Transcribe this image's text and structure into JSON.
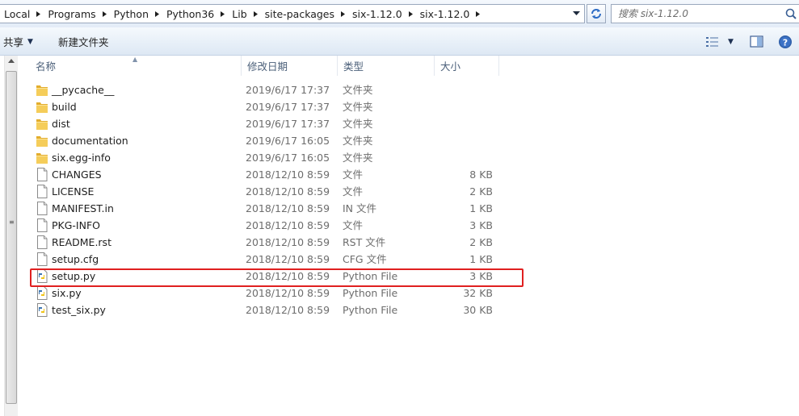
{
  "address_bar": {
    "breadcrumbs": [
      "Local",
      "Programs",
      "Python",
      "Python36",
      "Lib",
      "site-packages",
      "six-1.12.0",
      "six-1.12.0"
    ]
  },
  "search": {
    "placeholder": "搜索 six-1.12.0"
  },
  "toolbar": {
    "share_label": "共享",
    "new_folder_label": "新建文件夹"
  },
  "columns": {
    "name": "名称",
    "date": "修改日期",
    "type": "类型",
    "size": "大小"
  },
  "files": [
    {
      "name": "__pycache__",
      "date": "2019/6/17 17:37",
      "type": "文件夹",
      "size": "",
      "icon": "folder-icon"
    },
    {
      "name": "build",
      "date": "2019/6/17 17:37",
      "type": "文件夹",
      "size": "",
      "icon": "folder-icon"
    },
    {
      "name": "dist",
      "date": "2019/6/17 17:37",
      "type": "文件夹",
      "size": "",
      "icon": "folder-icon"
    },
    {
      "name": "documentation",
      "date": "2019/6/17 16:05",
      "type": "文件夹",
      "size": "",
      "icon": "folder-icon"
    },
    {
      "name": "six.egg-info",
      "date": "2019/6/17 16:05",
      "type": "文件夹",
      "size": "",
      "icon": "folder-icon"
    },
    {
      "name": "CHANGES",
      "date": "2018/12/10 8:59",
      "type": "文件",
      "size": "8 KB",
      "icon": "file-icon"
    },
    {
      "name": "LICENSE",
      "date": "2018/12/10 8:59",
      "type": "文件",
      "size": "2 KB",
      "icon": "file-icon"
    },
    {
      "name": "MANIFEST.in",
      "date": "2018/12/10 8:59",
      "type": "IN 文件",
      "size": "1 KB",
      "icon": "file-icon"
    },
    {
      "name": "PKG-INFO",
      "date": "2018/12/10 8:59",
      "type": "文件",
      "size": "3 KB",
      "icon": "file-icon"
    },
    {
      "name": "README.rst",
      "date": "2018/12/10 8:59",
      "type": "RST 文件",
      "size": "2 KB",
      "icon": "file-icon"
    },
    {
      "name": "setup.cfg",
      "date": "2018/12/10 8:59",
      "type": "CFG 文件",
      "size": "1 KB",
      "icon": "file-icon"
    },
    {
      "name": "setup.py",
      "date": "2018/12/10 8:59",
      "type": "Python File",
      "size": "3 KB",
      "icon": "python-file-icon"
    },
    {
      "name": "six.py",
      "date": "2018/12/10 8:59",
      "type": "Python File",
      "size": "32 KB",
      "icon": "python-file-icon"
    },
    {
      "name": "test_six.py",
      "date": "2018/12/10 8:59",
      "type": "Python File",
      "size": "30 KB",
      "icon": "python-file-icon"
    }
  ],
  "highlighted_file": "setup.py",
  "colors": {
    "highlight_border": "#e02020",
    "folder": "#e8b93b",
    "header_text": "#4c607a"
  }
}
